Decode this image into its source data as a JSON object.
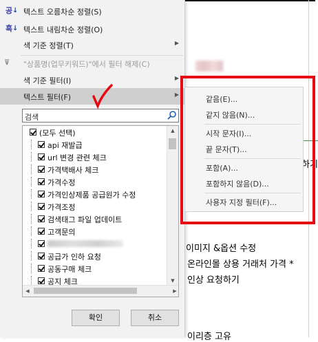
{
  "sheet": {
    "texts": [
      "이미지 &옵션 수정",
      "온라인몰 상용 거래처 가격 *",
      "인상 요청하기",
      "하기",
      "이리층 고유"
    ]
  },
  "menu": {
    "left_glyphs": [
      "공",
      "흑"
    ],
    "items": [
      {
        "label": "텍스트 오름차순 정렬(S)",
        "icon": "sort-ascending-icon",
        "disabled": false,
        "arrow": false
      },
      {
        "label": "텍스트 내림차순 정렬(O)",
        "icon": "sort-descending-icon",
        "disabled": false,
        "arrow": false
      },
      {
        "label": "색 기준 정렬(T)",
        "icon": "",
        "disabled": false,
        "arrow": true
      },
      {
        "label": "\"상품명(업무키워드)\"에서 필터 해제(C)",
        "icon": "clear-filter-icon",
        "disabled": true,
        "arrow": false
      },
      {
        "label": "색 기준 필터(I)",
        "icon": "",
        "disabled": false,
        "arrow": true
      },
      {
        "label": "텍스트 필터(F)",
        "icon": "",
        "disabled": false,
        "arrow": true,
        "highlighted": true
      }
    ],
    "search_placeholder": "검색",
    "list": [
      "(모두 선택)",
      "api 재발급",
      "url 변경 관련 체크",
      "가격택배사 체크",
      "가격수정",
      "가격인상제품 공급원가 수정",
      "가격조정",
      "검색태그 파일 업데이트",
      "고객문의",
      "",
      "공급가 인하 요청",
      "공동구매 체크",
      "공지 체크"
    ],
    "ok_label": "확인",
    "cancel_label": "취소"
  },
  "submenu": {
    "items": [
      "같음(E)...",
      "같지 않음(N)...",
      "시작 문자(I)...",
      "끝 문자(T)...",
      "포함(A)...",
      "포함하지 않음(D)...",
      "사용자 지정 필터(F)..."
    ]
  },
  "colors": {
    "annotation_red": "#e50914",
    "menu_bg": "#f2f2f2",
    "highlight": "#cfcfcf"
  }
}
